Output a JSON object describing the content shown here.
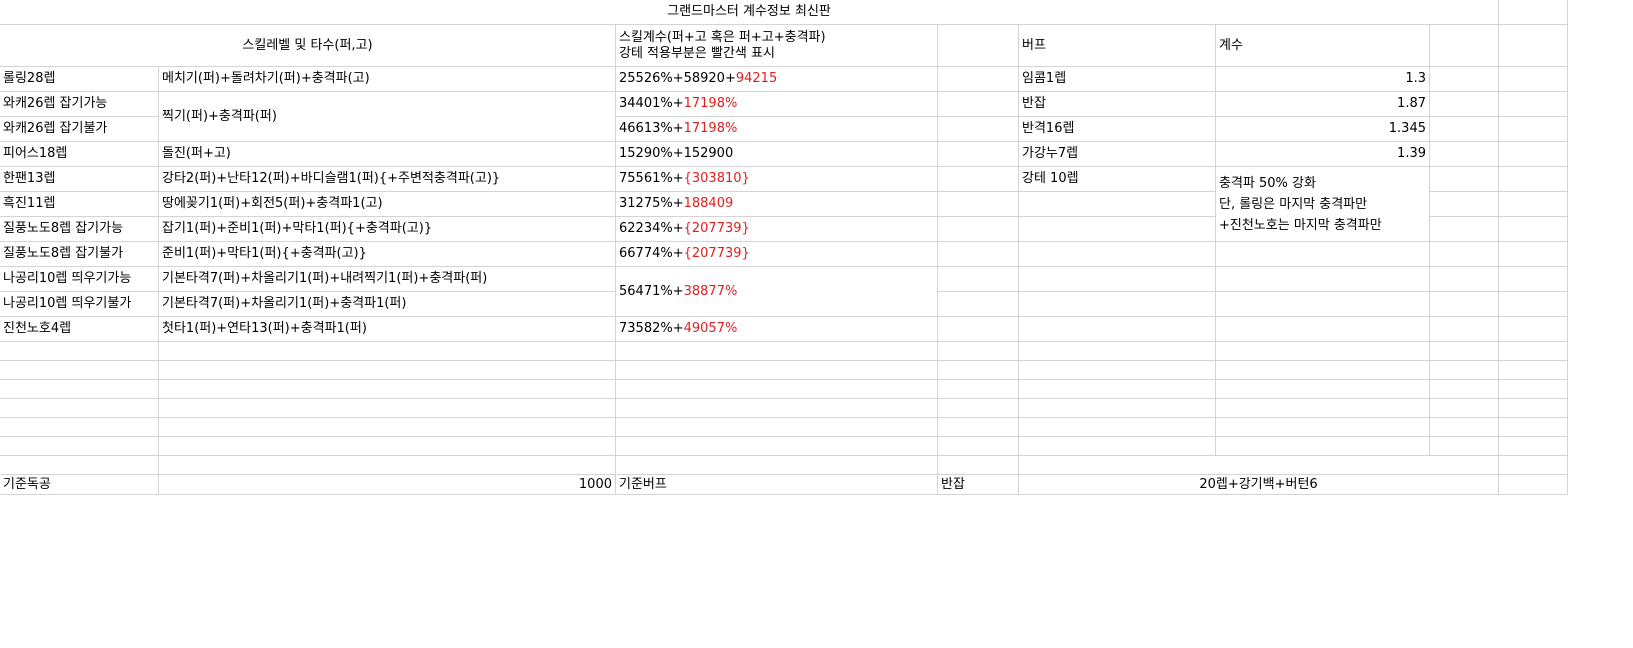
{
  "title": "그랜드마스터 계수정보 최신판",
  "headers": {
    "skill_level": "스킬레벨 및 타수(퍼,고)",
    "coef_line1": "스킬계수(퍼+고 혹은 퍼+고+충격파)",
    "coef_line2": "강테 적용부분은 빨간색 표시",
    "buff": "버프",
    "coef": "계수"
  },
  "rows": [
    {
      "name": "롤링28렙",
      "hits": "메치기(퍼)+돌려차기(퍼)+충격파(고)",
      "base": "25526%+58920+",
      "red": "94215"
    },
    {
      "name": "와캐26렙 잡기가능",
      "hits": "찍기(퍼)+충격파(퍼)",
      "base": "34401%+",
      "red": "17198%"
    },
    {
      "name": "와캐26렙 잡기불가",
      "hits": "",
      "base": "46613%+",
      "red": "17198%"
    },
    {
      "name": "피어스18렙",
      "hits": "돌진(퍼+고)",
      "base": "15290%+152900",
      "red": ""
    },
    {
      "name": "한팬13렙",
      "hits": "강타2(퍼)+난타12(퍼)+바디슬램1(퍼){+주변적충격파(고)}",
      "base": "75561%+",
      "red": "{303810}"
    },
    {
      "name": "흑진11렙",
      "hits": "땅에꽂기1(퍼)+회전5(퍼)+충격파1(고)",
      "base": "31275%+",
      "red": "188409"
    },
    {
      "name": "질풍노도8렙 잡기가능",
      "hits": "잡기1(퍼)+준비1(퍼)+막타1(퍼){+충격파(고)}",
      "base": "62234%+",
      "red": "{207739}"
    },
    {
      "name": "질풍노도8렙 잡기불가",
      "hits": "준비1(퍼)+막타1(퍼){+충격파(고)}",
      "base": "66774%+",
      "red": "{207739}"
    },
    {
      "name": "나공리10렙 띄우기가능",
      "hits": "기본타격7(퍼)+차올리기1(퍼)+내려찍기1(퍼)+충격파(퍼)",
      "base": "56471%+",
      "red": "38877%"
    },
    {
      "name": "나공리10렙 띄우기불가",
      "hits": "기본타격7(퍼)+차올리기1(퍼)+충격파1(퍼)",
      "base": "",
      "red": ""
    },
    {
      "name": "진천노호4렙",
      "hits": "첫타1(퍼)+연타13(퍼)+충격파1(퍼)",
      "base": "73582%+",
      "red": "49057%"
    }
  ],
  "buffs": [
    {
      "name": "임콤1렙",
      "value": "1.3"
    },
    {
      "name": "반잡",
      "value": "1.87"
    },
    {
      "name": "반격16렙",
      "value": "1.345"
    },
    {
      "name": "가강누7렙",
      "value": "1.39"
    },
    {
      "name": "강테 10렙",
      "value": ""
    }
  ],
  "note": {
    "line1": "충격파 50% 강화",
    "line2": "단, 롤링은 마지막 충격파만",
    "line3": "+진천노호는 마지막 충격파만"
  },
  "footer": {
    "label_stat": "기준독공",
    "stat_value": "1000",
    "label_buff": "기준버프",
    "buff_name": "반잡",
    "buff_desc": "20렙+강기백+버턴6"
  }
}
